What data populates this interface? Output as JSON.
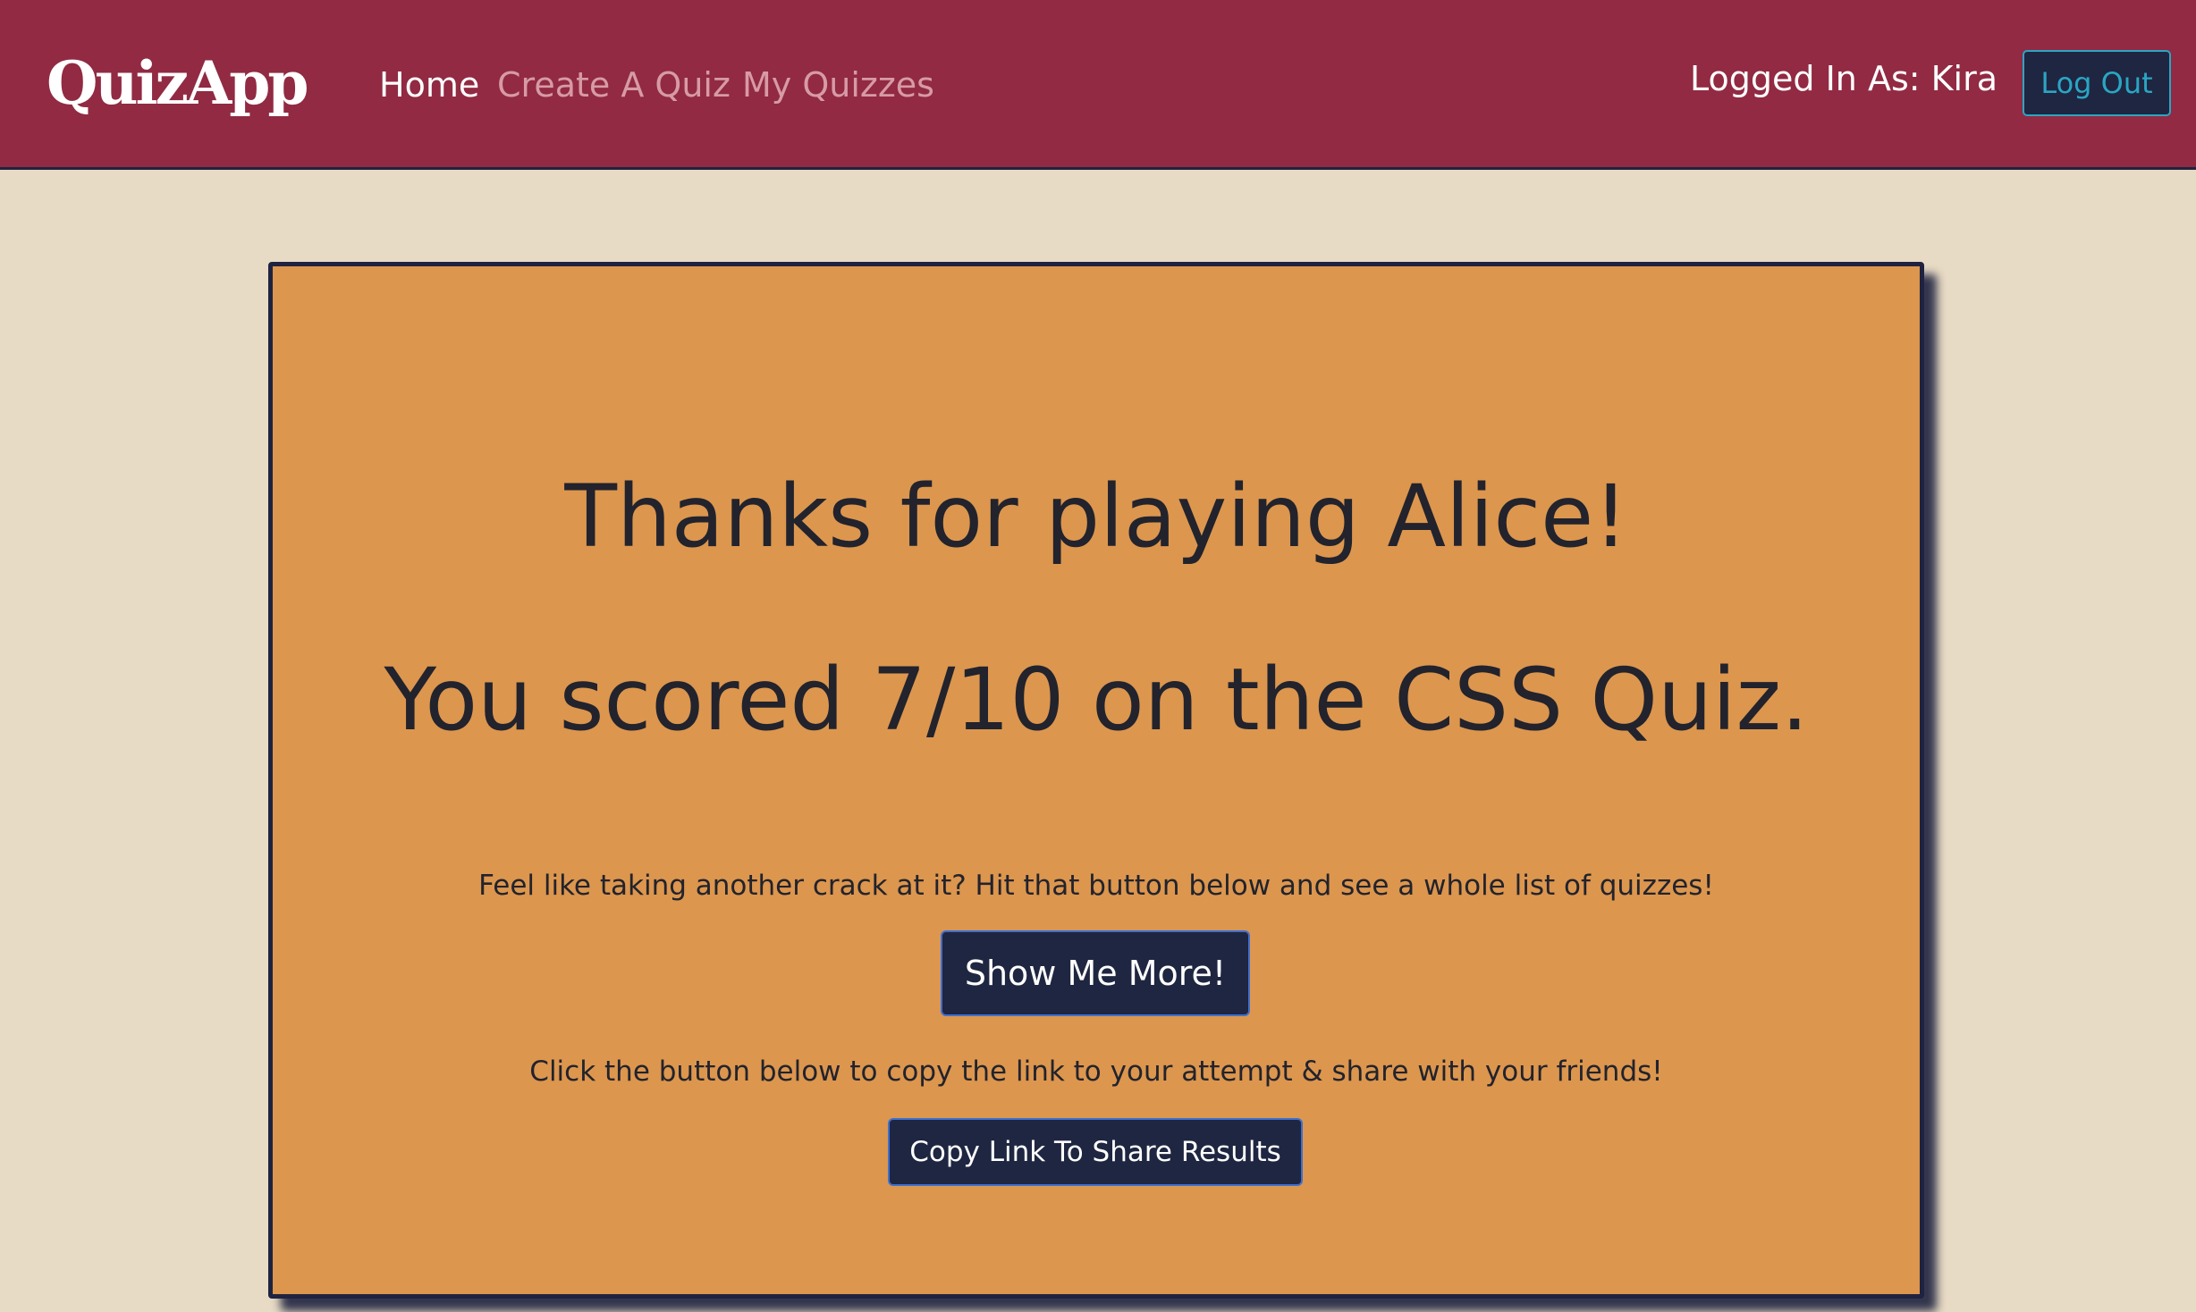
{
  "navbar": {
    "brand": "QuizApp",
    "links": [
      {
        "label": "Home",
        "active": true
      },
      {
        "label": "Create A Quiz",
        "active": false
      },
      {
        "label": "My Quizzes",
        "active": false
      }
    ],
    "logged_in_text": "Logged In As: Kira",
    "logout_label": "Log Out"
  },
  "result": {
    "thanks_heading": "Thanks for playing Alice!",
    "score_heading": "You scored 7/10 on the CSS Quiz.",
    "retry_prompt": "Feel like taking another crack at it? Hit that button below and see a whole list of quizzes!",
    "show_more_label": "Show Me More!",
    "share_prompt": "Click the button below to copy the link to your attempt & share with your friends!",
    "copy_link_label": "Copy Link To Share Results"
  },
  "colors": {
    "navbar_bg": "#912a42",
    "page_bg": "#e8dbc5",
    "card_bg": "#dc964e",
    "button_bg": "#1f2641",
    "logout_accent": "#2aa6c4",
    "inactive_link": "#d79aa6"
  }
}
